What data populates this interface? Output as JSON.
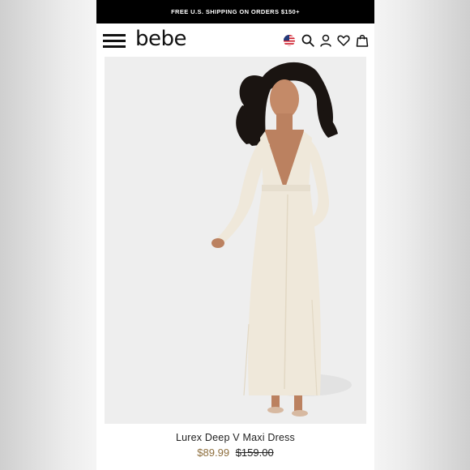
{
  "promo_banner": {
    "text": "FREE U.S. SHIPPING ON ORDERS $150+"
  },
  "header": {
    "logo": "bebe",
    "icons": [
      "menu-icon",
      "us-flag-icon",
      "search-icon",
      "account-icon",
      "heart-icon",
      "shopping-bag-icon"
    ]
  },
  "product": {
    "title": "Lurex Deep V Maxi Dress",
    "sale_price": "$89.99",
    "original_price": "$159.00"
  },
  "colors": {
    "promo_background": "#000000",
    "sale_price": "#8e6f3e",
    "image_background": "#eeeeee",
    "dress": "#efe8da"
  }
}
